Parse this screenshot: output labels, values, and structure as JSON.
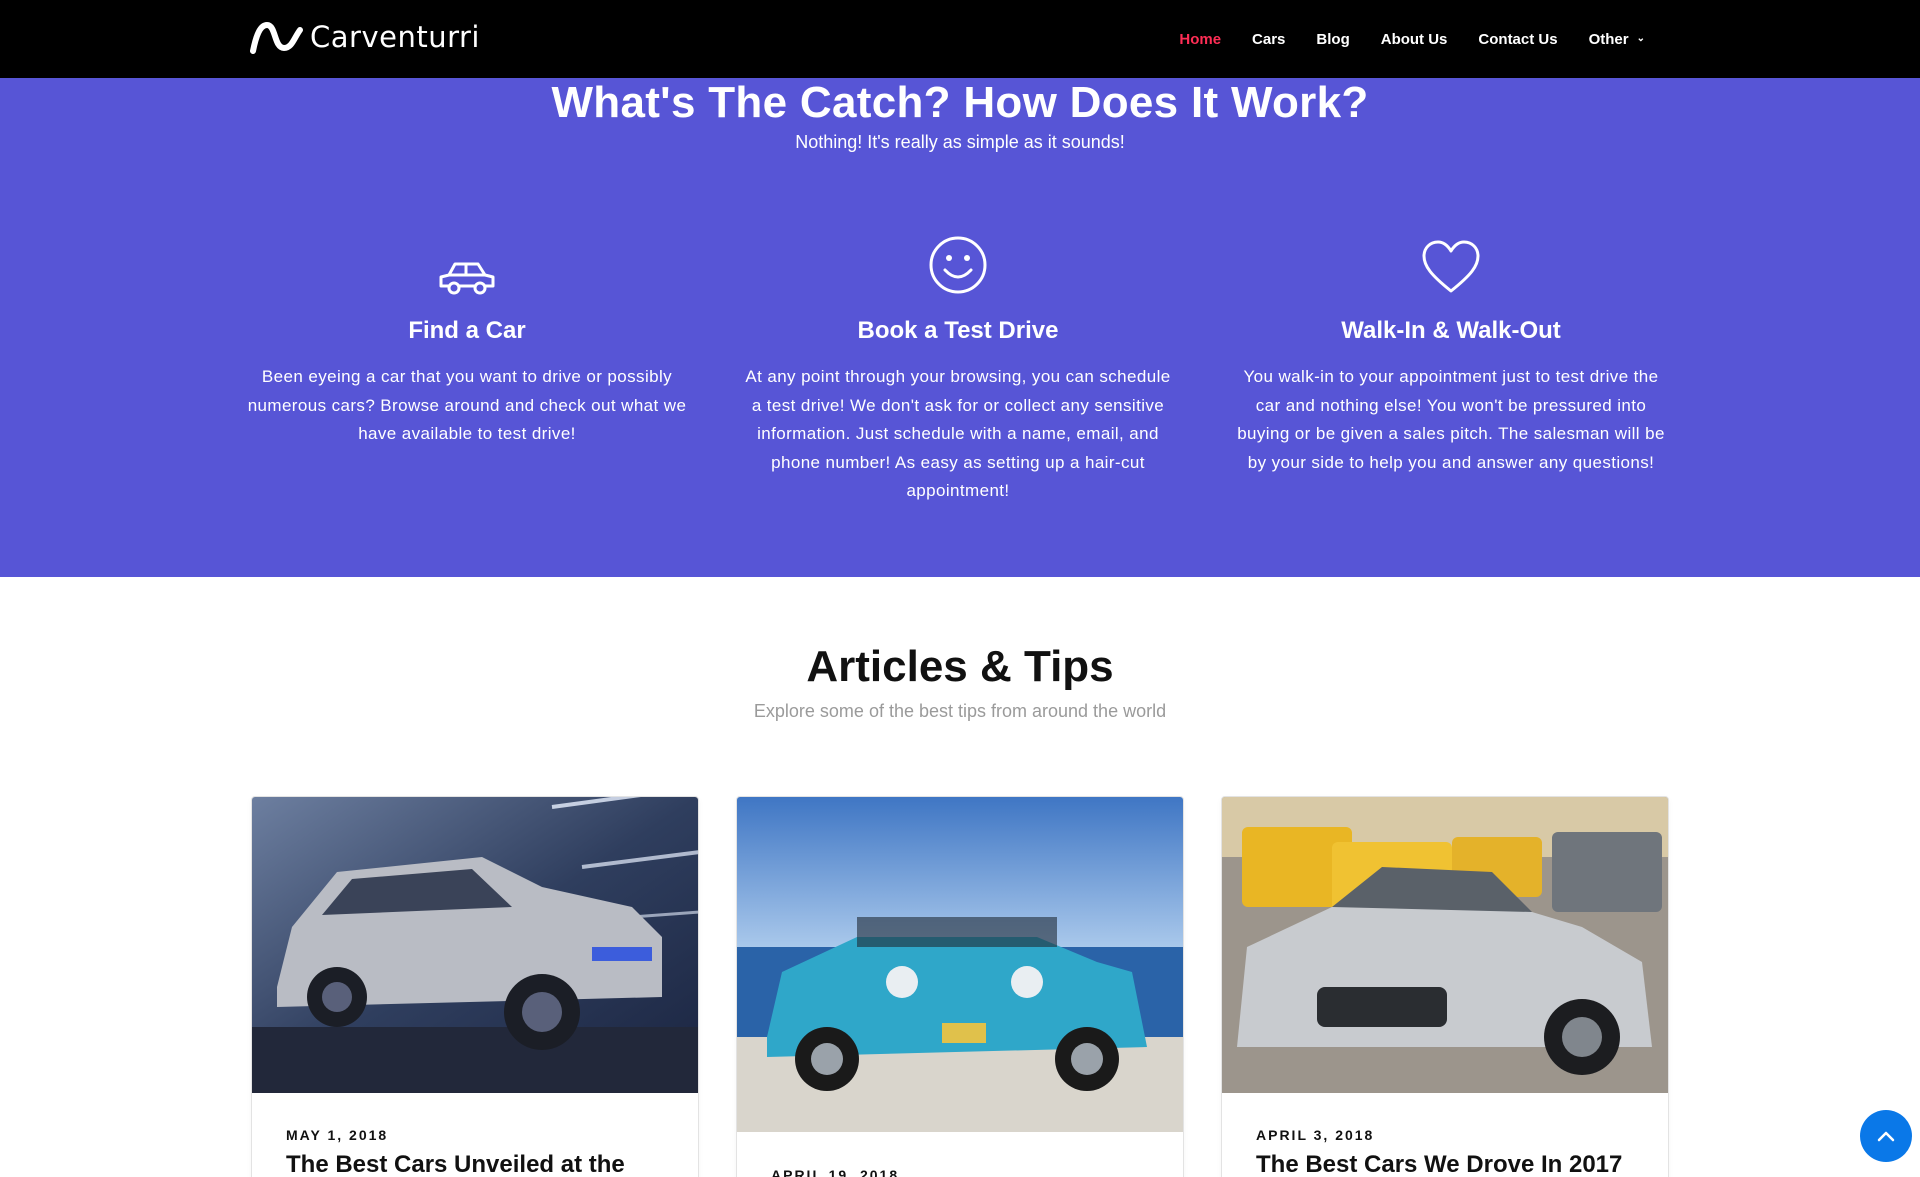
{
  "brand": {
    "name": "Carventurri"
  },
  "nav": {
    "items": [
      {
        "label": "Home",
        "active": true
      },
      {
        "label": "Cars"
      },
      {
        "label": "Blog"
      },
      {
        "label": "About Us"
      },
      {
        "label": "Contact Us"
      },
      {
        "label": "Other",
        "dropdown": true
      }
    ]
  },
  "hero": {
    "title": "What's The Catch? How Does It Work?",
    "subtitle": "Nothing! It's really as simple as it sounds!",
    "background": "#5755d6",
    "features": [
      {
        "icon": "car-icon",
        "title": "Find a Car",
        "text": "Been eyeing a car that you want to drive or possibly numerous cars? Browse around and check out what we have available to test drive!"
      },
      {
        "icon": "smiley-icon",
        "title": "Book a Test Drive",
        "text": "At any point through your browsing, you can schedule a test drive! We don't ask for or collect any sensitive information. Just schedule with a name, email, and phone number! As easy as setting up a hair-cut appointment!"
      },
      {
        "icon": "heart-icon",
        "title": "Walk-In & Walk-Out",
        "text": "You walk-in to your appointment just to test drive the car and nothing else! You won't be pressured into buying or be given a sales pitch. The salesman will be by your side to help you and answer any questions!"
      }
    ]
  },
  "articles": {
    "title": "Articles & Tips",
    "subtitle": "Explore some of the best tips from around the world",
    "cards": [
      {
        "date": "MAY 1, 2018",
        "title": "The Best Cars Unveiled at the",
        "image": "silver-suv-photo"
      },
      {
        "date": "APRIL 19, 2018",
        "title": "",
        "image": "blue-convertible-photo"
      },
      {
        "date": "APRIL 3, 2018",
        "title": "The Best Cars We Drove In 2017",
        "image": "silver-sports-car-photo"
      }
    ]
  },
  "colors": {
    "accent": "#ff2d55",
    "hero": "#5755d6",
    "scroll_button": "#0a78e8"
  }
}
